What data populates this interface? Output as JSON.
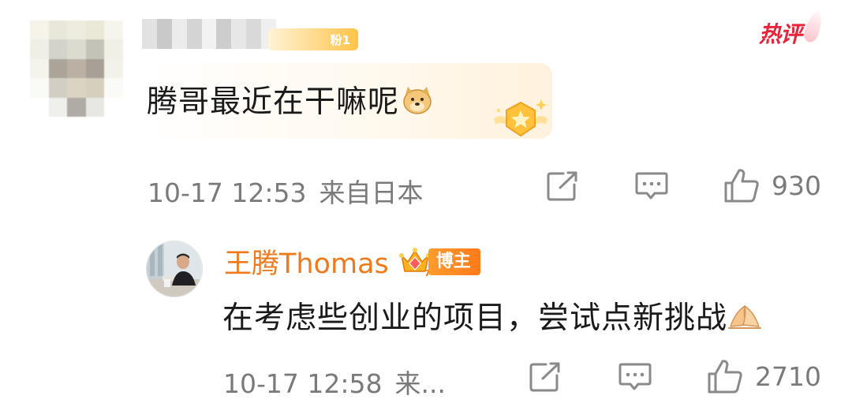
{
  "comment": {
    "username": "",
    "fans_badge": "粉1",
    "hot_tag": "热评",
    "text": "腾哥最近在干嘛呢",
    "emoji": "doge-emoji",
    "timestamp": "10-17 12:53",
    "location": "来自日本",
    "likes": "930"
  },
  "reply": {
    "username": "王腾Thomas",
    "badge_icon": "crown-icon",
    "role_tag": "博主",
    "text": "在考虑些创业的项目，尝试点新挑战",
    "emoji": "folded-hands-emoji",
    "timestamp": "10-17 12:58",
    "location": "来...",
    "likes": "2710"
  },
  "colors": {
    "accent_orange": "#ef7a1c",
    "hot_red": "#e9233a",
    "meta_gray": "#7a7a7a"
  }
}
